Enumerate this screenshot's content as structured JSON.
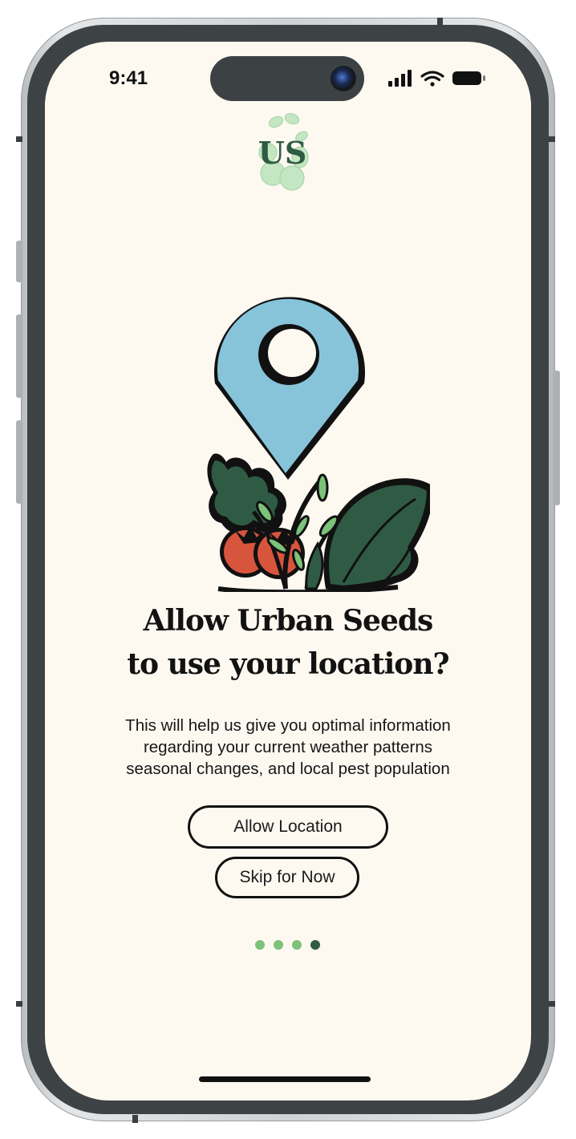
{
  "status_bar": {
    "time": "9:41"
  },
  "logo": {
    "text": "US"
  },
  "prompt": {
    "title_line1": "Allow Urban Seeds",
    "title_line2": "to use your location?",
    "body_lines": [
      "This will help us give you optimal information",
      "regarding your current weather patterns",
      "seasonal changes, and local pest population"
    ]
  },
  "actions": {
    "allow_label": "Allow Location",
    "skip_label": "Skip for Now"
  },
  "pagination": {
    "total": 4,
    "current": 4
  },
  "colors": {
    "background": "#fdf9f1",
    "pin": "#87c4da",
    "leaf_dark": "#2f5b45",
    "leaf_light": "#7cc279",
    "tomato": "#d8553d",
    "dot_inactive": "#7cc279",
    "dot_active": "#2f5b45"
  },
  "icons": [
    "signal-icon",
    "wifi-icon",
    "battery-icon",
    "location-pin-icon"
  ]
}
